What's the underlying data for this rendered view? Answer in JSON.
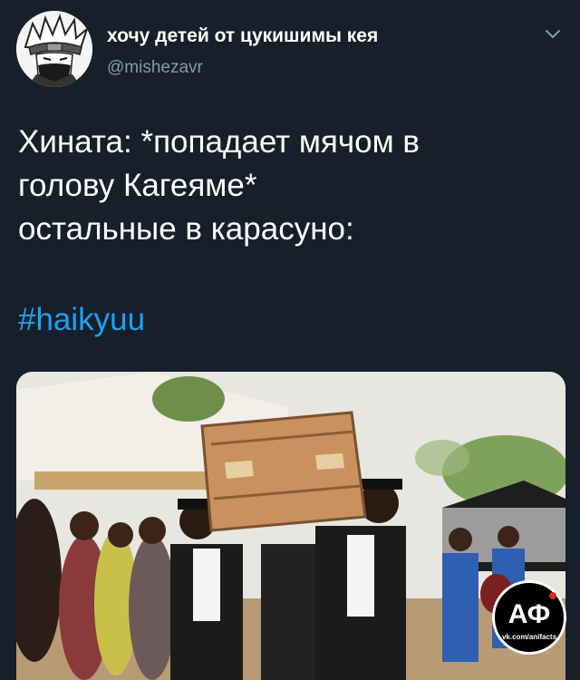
{
  "tweet": {
    "author": {
      "display_name": "хочу детей от цукишимы кея",
      "handle": "@mishezavr",
      "avatar_icon": "anime-avatar-icon"
    },
    "menu_icon": "chevron-down-icon",
    "text_lines": [
      "Хината: *попадает мячом в",
      "голову Кагеяме*",
      "остальные в карасуно:"
    ],
    "hashtag": "#haikyuu",
    "media": {
      "description_icon": "coffin-dance-photo",
      "watermark_text": "АФ",
      "watermark_subtext": "vk.com/anifacts"
    }
  },
  "colors": {
    "background": "#15202b",
    "text": "#ffffff",
    "secondary_text": "#8899a6",
    "link": "#1da1f2"
  }
}
